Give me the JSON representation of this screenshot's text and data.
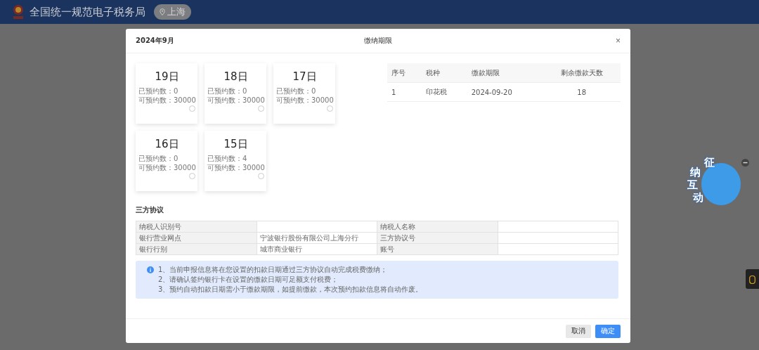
{
  "site_header": {
    "title": "全国统一规范电子税务局",
    "location": "上海"
  },
  "dialog": {
    "month": "2024年9月",
    "title": "缴纳期限",
    "close": "×",
    "day_cards": [
      {
        "day": "19日",
        "booked": "已预约数：0",
        "available": "可预约数：30000",
        "selected": false
      },
      {
        "day": "18日",
        "booked": "已预约数：0",
        "available": "可预约数：30000",
        "selected": false
      },
      {
        "day": "17日",
        "booked": "已预约数：0",
        "available": "可预约数：30000",
        "selected": false
      },
      {
        "day": "16日",
        "booked": "已预约数：0",
        "available": "可预约数：30000",
        "selected": false
      },
      {
        "day": "15日",
        "booked": "已预约数：4",
        "available": "可预约数：30000",
        "selected": false
      }
    ],
    "deadline_table": {
      "columns": [
        "序号",
        "税种",
        "缴款期限",
        "剩余缴款天数"
      ],
      "rows": [
        [
          "1",
          "印花税",
          "2024-09-20",
          "18"
        ]
      ]
    },
    "agreement": {
      "title": "三方协议",
      "rows": [
        [
          {
            "kind": "label",
            "text": "纳税人识别号"
          },
          {
            "kind": "value"
          },
          {
            "kind": "label",
            "text": "纳税人名称"
          },
          {
            "kind": "value"
          }
        ],
        [
          {
            "kind": "label",
            "text": "银行营业网点"
          },
          {
            "kind": "value",
            "text": "宁波银行股份有限公司上海分行"
          },
          {
            "kind": "label",
            "text": "三方协议号"
          },
          {
            "kind": "value"
          }
        ],
        [
          {
            "kind": "label",
            "text": "银行行别"
          },
          {
            "kind": "value",
            "text": "城市商业银行"
          },
          {
            "kind": "label",
            "text": "账号"
          },
          {
            "kind": "value"
          }
        ]
      ]
    },
    "notice": [
      "1、当前申报信息将在您设置的扣款日期通过三方协议自动完成税费缴纳；",
      "2、请确认签约银行卡在设置的缴款日期可足额支付税费；",
      "3、预约自动扣款日期需小于缴款期限，如提前缴款，本次预约扣款信息将自动作废。"
    ],
    "buttons": [
      {
        "label": "取消",
        "kind": "secondary"
      },
      {
        "label": "确定",
        "kind": "primary"
      }
    ]
  },
  "assistant_badge": {
    "text": "征纳互动"
  }
}
